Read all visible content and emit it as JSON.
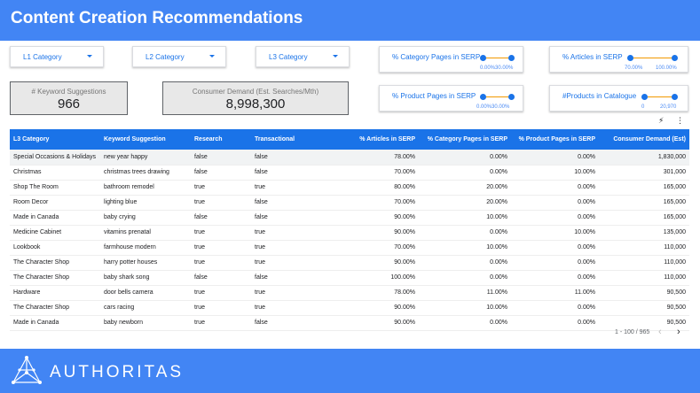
{
  "header": {
    "title": "Content Creation Recommendations"
  },
  "filters": {
    "l1": "L1 Category",
    "l2": "L2 Category",
    "l3": "L3 Category"
  },
  "scorecards": {
    "kw_label": "# Keyword Suggestions",
    "kw_value": "966",
    "demand_label": "Consumer Demand (Est. Searches/Mth)",
    "demand_value": "8,998,300"
  },
  "ranges": {
    "cat": {
      "label": "% Category Pages in SERP",
      "min": "0.00%",
      "max": "30.00%"
    },
    "art": {
      "label": "% Articles in SERP",
      "min": "70.00%",
      "max": "100.00%"
    },
    "prod": {
      "label": "% Product Pages in SERP",
      "min": "0.00%",
      "max": "30.00%"
    },
    "cata": {
      "label": "#Products in Catalogue",
      "min": "0",
      "max": "20,970"
    }
  },
  "toolbar": {
    "bolt": "⚡",
    "more": "⋮"
  },
  "table": {
    "headers": [
      "L3 Category",
      "Keyword Suggestion",
      "Research",
      "Transactional",
      "% Articles in SERP",
      "% Category Pages in SERP",
      "% Product Pages in SERP",
      "Consumer Demand (Est)"
    ],
    "rows": [
      [
        "Special Occasions & Holidays",
        "new year happy",
        "false",
        "false",
        "78.00%",
        "0.00%",
        "0.00%",
        "1,830,000"
      ],
      [
        "Christmas",
        "christmas trees drawing",
        "false",
        "false",
        "70.00%",
        "0.00%",
        "10.00%",
        "301,000"
      ],
      [
        "Shop The Room",
        "bathroom remodel",
        "true",
        "true",
        "80.00%",
        "20.00%",
        "0.00%",
        "165,000"
      ],
      [
        "Room Decor",
        "lighting blue",
        "true",
        "false",
        "70.00%",
        "20.00%",
        "0.00%",
        "165,000"
      ],
      [
        "Made in Canada",
        "baby crying",
        "false",
        "false",
        "90.00%",
        "10.00%",
        "0.00%",
        "165,000"
      ],
      [
        "Medicine Cabinet",
        "vitamins prenatal",
        "true",
        "true",
        "90.00%",
        "0.00%",
        "10.00%",
        "135,000"
      ],
      [
        "Lookbook",
        "farmhouse modern",
        "true",
        "true",
        "70.00%",
        "10.00%",
        "0.00%",
        "110,000"
      ],
      [
        "The Character Shop",
        "harry potter houses",
        "true",
        "true",
        "90.00%",
        "0.00%",
        "0.00%",
        "110,000"
      ],
      [
        "The Character Shop",
        "baby shark song",
        "false",
        "false",
        "100.00%",
        "0.00%",
        "0.00%",
        "110,000"
      ],
      [
        "Hardware",
        "door bells camera",
        "true",
        "true",
        "78.00%",
        "11.00%",
        "11.00%",
        "90,500"
      ],
      [
        "The Character Shop",
        "cars racing",
        "true",
        "true",
        "90.00%",
        "10.00%",
        "0.00%",
        "90,500"
      ],
      [
        "Made in Canada",
        "baby newborn",
        "true",
        "false",
        "90.00%",
        "0.00%",
        "0.00%",
        "90,500"
      ]
    ]
  },
  "pagination": {
    "range": "1 - 100 / 965",
    "prev": "‹",
    "next": "›"
  },
  "footer": {
    "brand": "AUTHORITAS"
  },
  "colors": {
    "accent": "#4285f4",
    "header_blue": "#1a73e8",
    "slider": "#f29900"
  }
}
